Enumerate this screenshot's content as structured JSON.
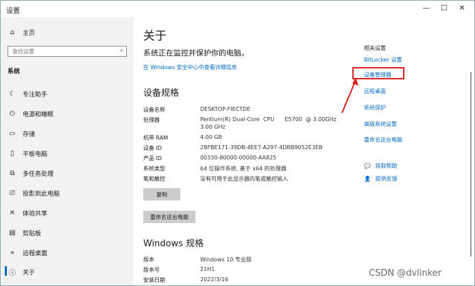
{
  "window": {
    "title": "设置",
    "minimize": "—",
    "maximize": "☐",
    "close": "✕"
  },
  "sidebar": {
    "home": {
      "label": "主页",
      "icon": "⌂"
    },
    "search": {
      "placeholder": "查找设置",
      "icon": "⌕"
    },
    "category": "系统",
    "items": [
      {
        "label": "专注助手",
        "icon": "☾"
      },
      {
        "label": "电源和睡眠",
        "icon": "⏻"
      },
      {
        "label": "存储",
        "icon": "▭"
      },
      {
        "label": "平板电脑",
        "icon": "▯"
      },
      {
        "label": "多任务处理",
        "icon": "⧉"
      },
      {
        "label": "投影到此电脑",
        "icon": "⎚"
      },
      {
        "label": "体验共享",
        "icon": "✕"
      },
      {
        "label": "剪贴板",
        "icon": "▤"
      },
      {
        "label": "远程桌面",
        "icon": "»"
      },
      {
        "label": "关于",
        "icon": "ⓘ"
      }
    ]
  },
  "main": {
    "title": "关于",
    "protection_text": "系统正在监控并保护你的电脑。",
    "security_link": "在 Windows 安全中心中查看详细信息",
    "device_specs": {
      "heading": "设备规格",
      "rows": [
        {
          "label": "设备名称",
          "value": "DESKTOP-FIECTDE"
        },
        {
          "label": "处理器",
          "value": "Pentium(R) Dual-Core  CPU      E5700  @ 3.00GHz",
          "value2": "3.00 GHz"
        },
        {
          "label": "机带 RAM",
          "value": "4.00 GB"
        },
        {
          "label": "设备 ID",
          "value": "2BFBE171-39DB-4EE7-A297-4DBB9052E3EB"
        },
        {
          "label": "产品 ID",
          "value": "00330-80000-00000-AA825"
        },
        {
          "label": "系统类型",
          "value": "64 位操作系统, 基于 x64 的处理器"
        },
        {
          "label": "笔和触控",
          "value": "没有可用于此显示器的笔或触控输入"
        }
      ],
      "copy_button": "复制",
      "rename_button": "重命名这台电脑"
    },
    "windows_specs": {
      "heading": "Windows 规格",
      "rows": [
        {
          "label": "版本",
          "value": "Windows 10 专业版"
        },
        {
          "label": "版本号",
          "value": "21H1"
        },
        {
          "label": "安装日期",
          "value": "2022/3/16"
        }
      ]
    }
  },
  "related": {
    "title": "相关设置",
    "links": [
      "BitLocker 设置",
      "设备管理器",
      "远程桌面",
      "系统保护",
      "高级系统设置",
      "重命名这台电脑"
    ],
    "help": {
      "label": "获取帮助",
      "icon": "💬"
    },
    "feedback": {
      "label": "提供反馈",
      "icon": "👤"
    }
  },
  "watermark": "CSDN @dvlinker",
  "colors": {
    "accent": "#0067c0",
    "highlight": "#e02020"
  }
}
